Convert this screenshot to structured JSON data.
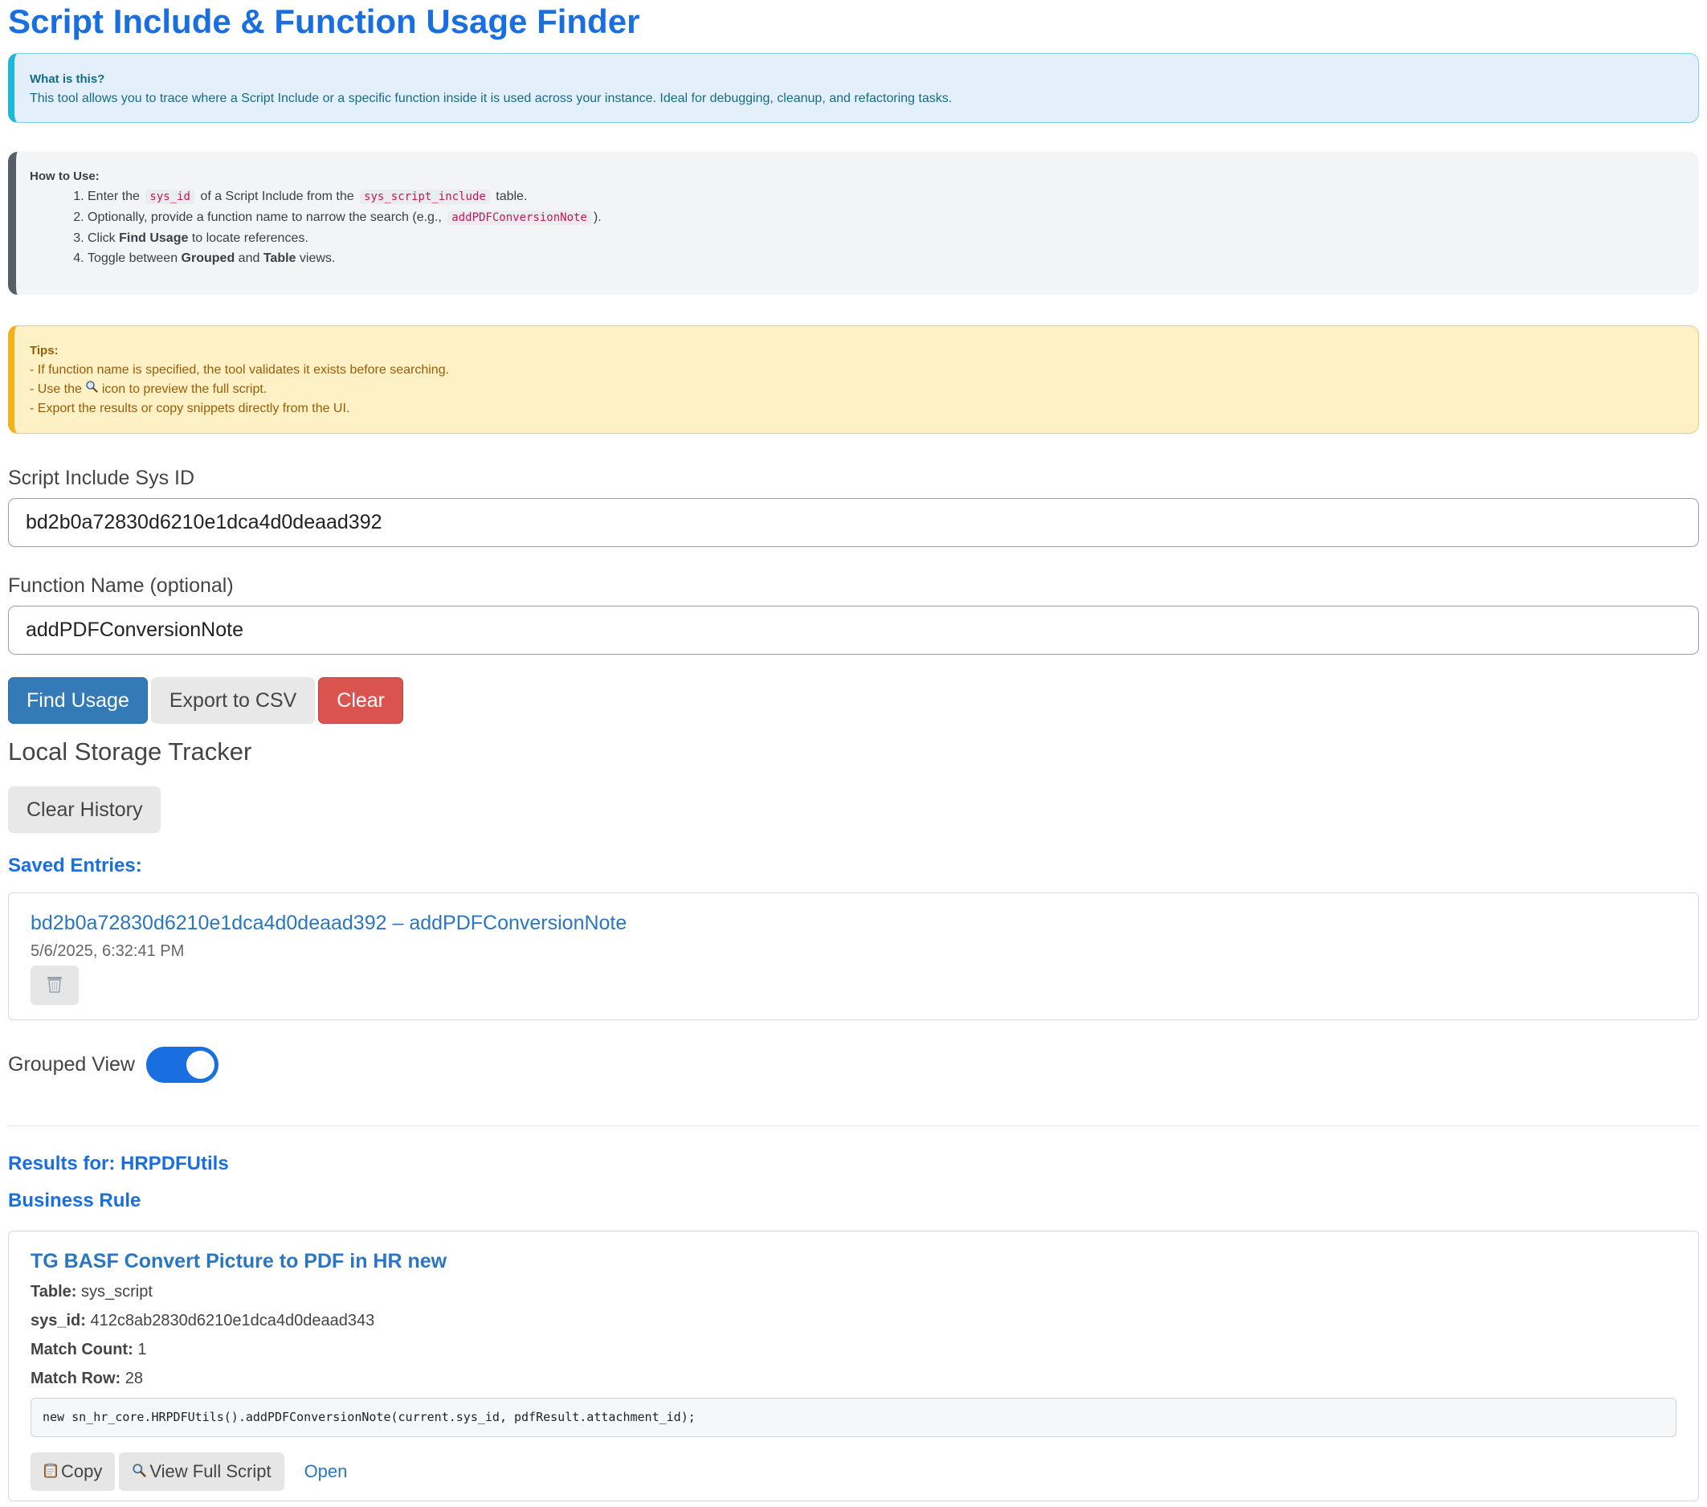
{
  "page": {
    "title": "Script Include & Function Usage Finder"
  },
  "info": {
    "heading": "What is this?",
    "text": "This tool allows you to trace where a Script Include or a specific function inside it is used across your instance. Ideal for debugging, cleanup, and refactoring tasks."
  },
  "howto": {
    "heading": "How to Use:",
    "step1": {
      "a": "Enter the",
      "code1": "sys_id",
      "b": "of a Script Include from the",
      "code2": "sys_script_include",
      "c": "table."
    },
    "step2": {
      "a": "Optionally, provide a function name to narrow the search (e.g.,",
      "code": "addPDFConversionNote",
      "b": ")."
    },
    "step3": {
      "a": "Click",
      "bold": "Find Usage",
      "b": "to locate references."
    },
    "step4": {
      "a": "Toggle between",
      "bold1": "Grouped",
      "b": "and",
      "bold2": "Table",
      "c": "views."
    }
  },
  "tips": {
    "heading": "Tips:",
    "line1": "- If function name is specified, the tool validates it exists before searching.",
    "line2a": "- Use the",
    "line2b": "icon to preview the full script.",
    "line3": "- Export the results or copy snippets directly from the UI."
  },
  "form": {
    "sysid_label": "Script Include Sys ID",
    "sysid_value": "bd2b0a72830d6210e1dca4d0deaad392",
    "fn_label": "Function Name (optional)",
    "fn_value": "addPDFConversionNote"
  },
  "buttons": {
    "find": "Find Usage",
    "export": "Export to CSV",
    "clear": "Clear"
  },
  "storage": {
    "heading": "Local Storage Tracker",
    "clear_history": "Clear History",
    "saved_heading": "Saved Entries:",
    "entries": [
      {
        "label": "bd2b0a72830d6210e1dca4d0deaad392 – addPDFConversionNote",
        "date": "5/6/2025, 6:32:41 PM"
      }
    ]
  },
  "view_toggle": {
    "label": "Grouped View",
    "on": true
  },
  "results": {
    "heading": "Results for: HRPDFUtils",
    "group": "Business Rule",
    "items": [
      {
        "title": "TG BASF Convert Picture to PDF in HR new",
        "table_label": "Table:",
        "table": "sys_script",
        "sysid_label": "sys_id:",
        "sysid": "412c8ab2830d6210e1dca4d0deaad343",
        "count_label": "Match Count:",
        "count": "1",
        "row_label": "Match Row:",
        "row": "28",
        "snippet": "new sn_hr_core.HRPDFUtils().addPDFConversionNote(current.sys_id, pdfResult.attachment_id);",
        "copy": "Copy",
        "view": "View Full Script",
        "open": "Open"
      }
    ]
  },
  "colors": {
    "accent": "#1a6fe0",
    "primary": "#337ab7",
    "danger": "#d9534f"
  }
}
